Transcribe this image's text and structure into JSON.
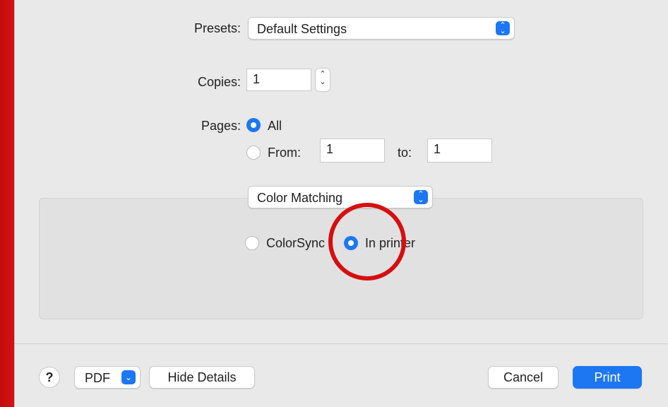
{
  "presets": {
    "label": "Presets:",
    "value": "Default Settings"
  },
  "copies": {
    "label": "Copies:",
    "value": "1"
  },
  "pages": {
    "label": "Pages:",
    "all_label": "All",
    "from_label": "From:",
    "from_value": "1",
    "to_label": "to:",
    "to_value": "1",
    "selected": "All"
  },
  "section_popup": {
    "value": "Color Matching"
  },
  "color_matching": {
    "option1": "ColorSync",
    "option2": "In printer",
    "selected": "In printer"
  },
  "footer": {
    "help": "?",
    "pdf": "PDF",
    "hide_details": "Hide Details",
    "cancel": "Cancel",
    "print": "Print"
  },
  "colors": {
    "accent": "#1d77f2",
    "annotation": "#d50f10",
    "background_frame": "#d90f10"
  },
  "icons": {
    "popup_arrows": "up-down-chevron-icon",
    "pdf_menu": "chevron-down-icon"
  }
}
